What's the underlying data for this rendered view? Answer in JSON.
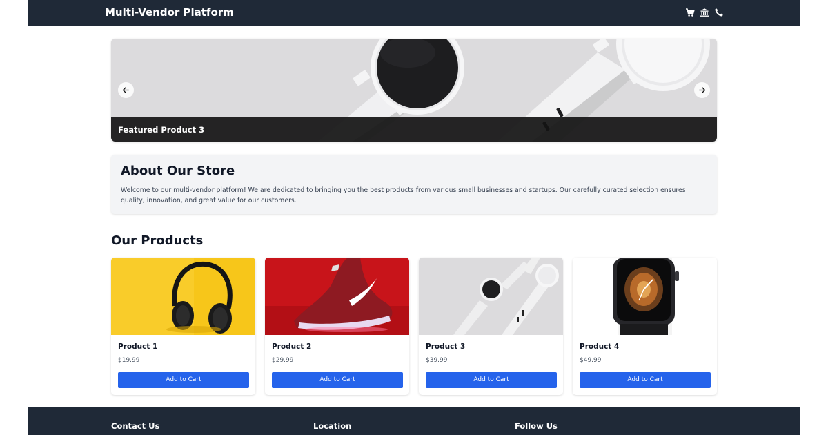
{
  "header": {
    "brand": "Multi-Vendor Platform",
    "icons": [
      "cart-icon",
      "bank-icon",
      "phone-icon"
    ]
  },
  "carousel": {
    "caption": "Featured Product 3",
    "prev_icon": "arrow-left-icon",
    "next_icon": "arrow-right-icon"
  },
  "about": {
    "title": "About Our Store",
    "text": "Welcome to our multi-vendor platform! We are dedicated to bringing you the best products from various small businesses and startups. Our carefully curated selection ensures quality, innovation, and great value for our customers."
  },
  "products": {
    "title": "Our Products",
    "items": [
      {
        "name": "Product 1",
        "price": "$19.99",
        "button": "Add to Cart",
        "image": "headphones-image"
      },
      {
        "name": "Product 2",
        "price": "$29.99",
        "button": "Add to Cart",
        "image": "red-sneaker-image"
      },
      {
        "name": "Product 3",
        "price": "$39.99",
        "button": "Add to Cart",
        "image": "white-watches-image"
      },
      {
        "name": "Product 4",
        "price": "$49.99",
        "button": "Add to Cart",
        "image": "smartwatch-image"
      }
    ]
  },
  "footer": {
    "headings": [
      "Contact Us",
      "Location",
      "Follow Us"
    ]
  },
  "colors": {
    "header_bg": "#1f2937",
    "button": "#2563eb",
    "panel_bg": "#f3f4f6"
  }
}
